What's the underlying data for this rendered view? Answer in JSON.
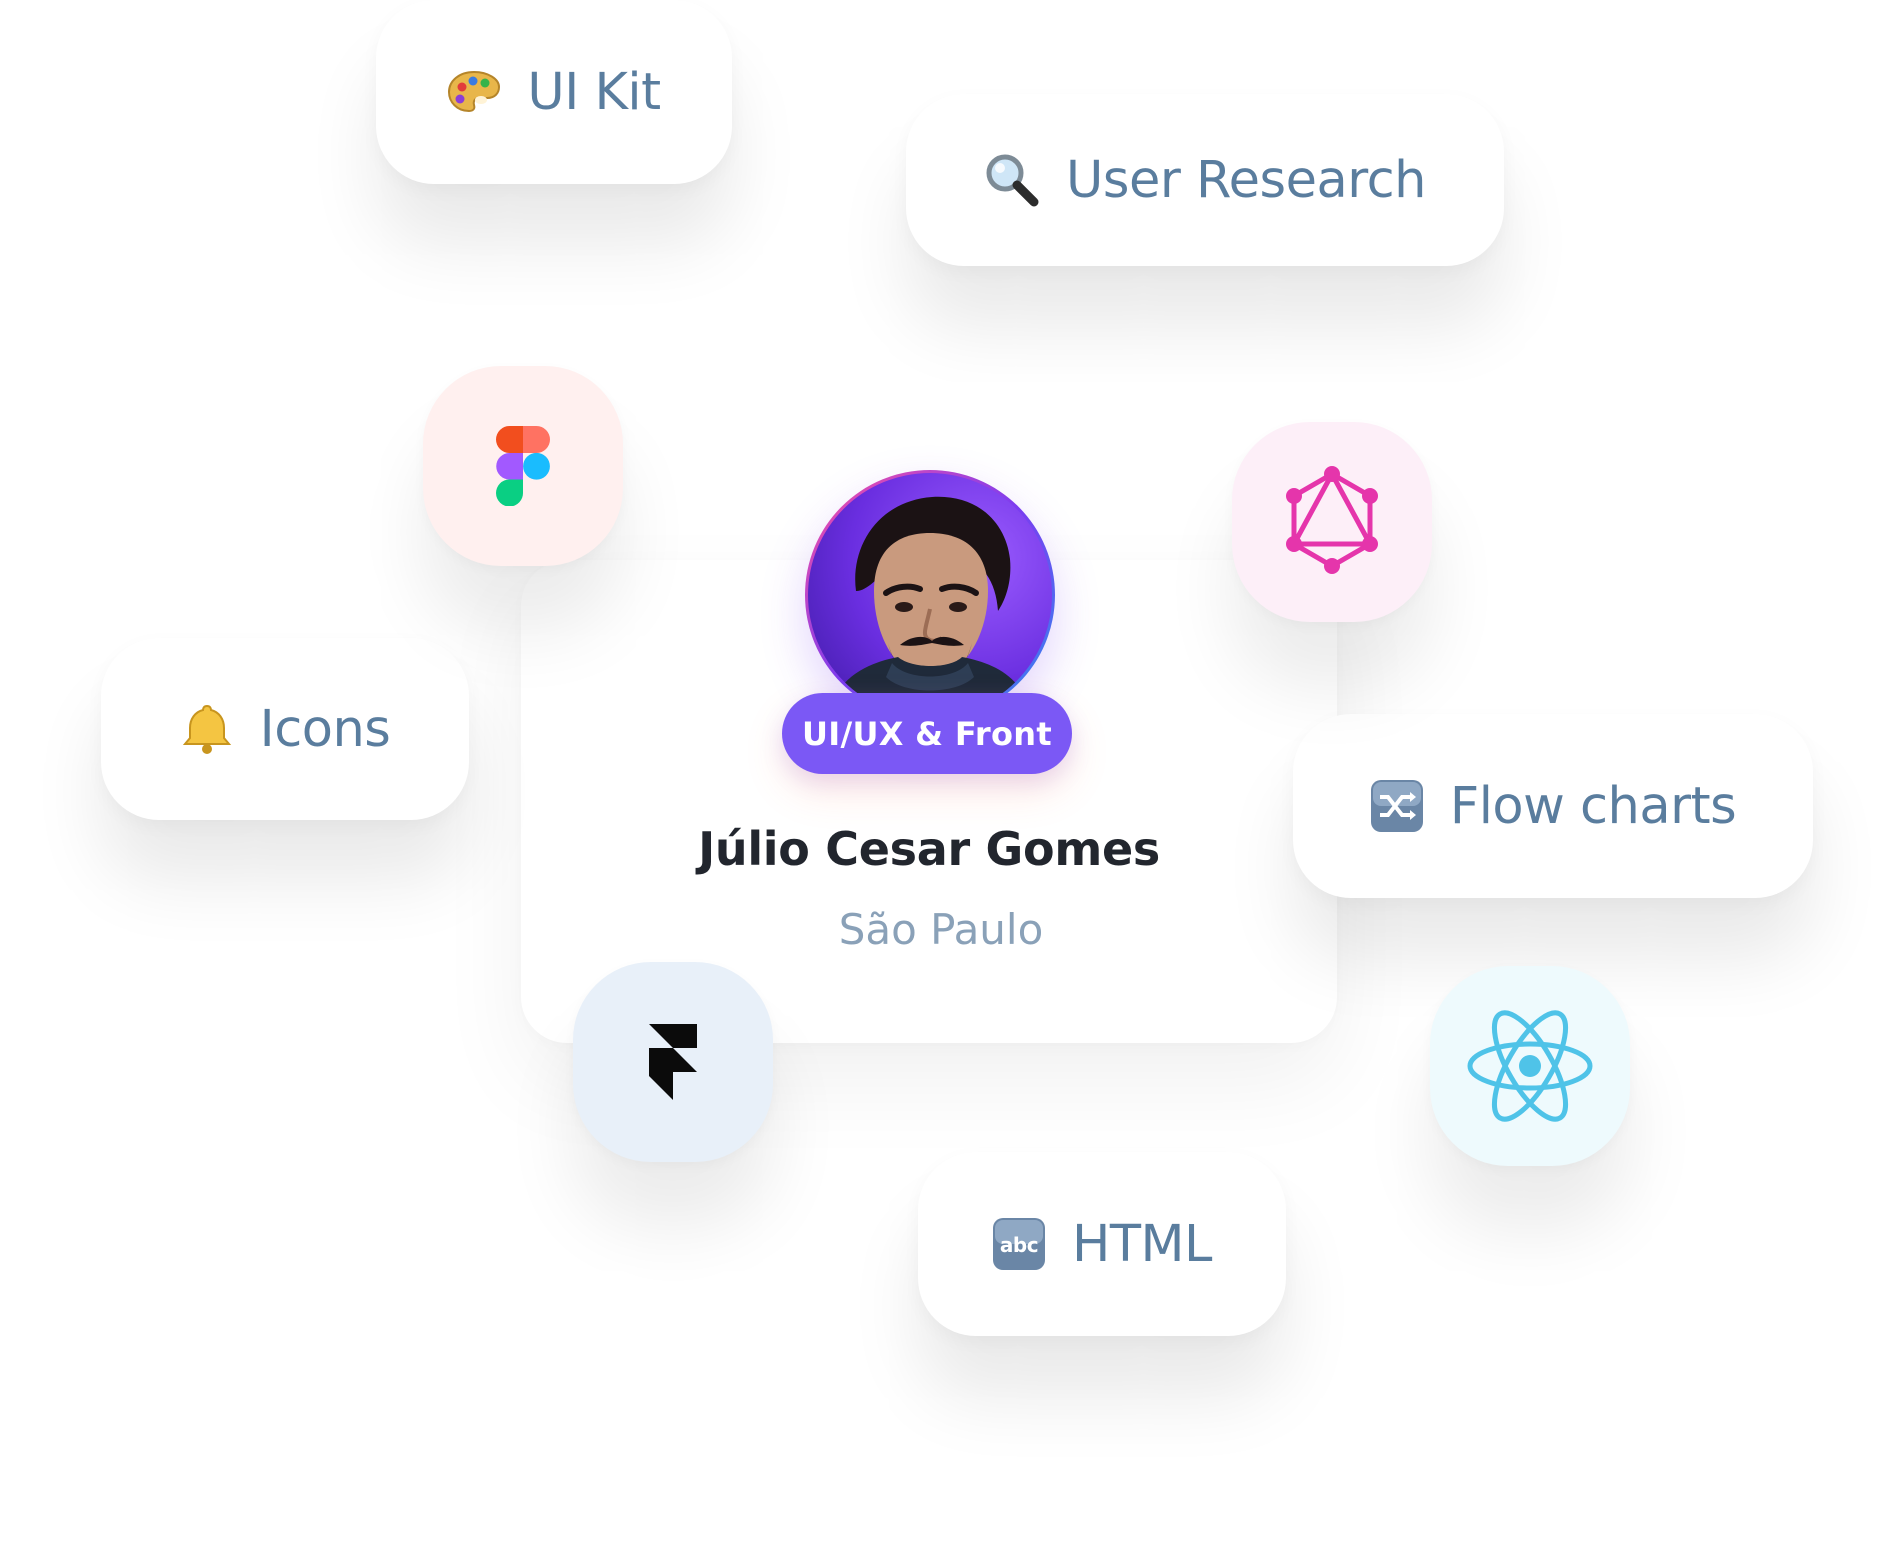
{
  "profile": {
    "role_badge": "UI/UX & Front",
    "name": "Júlio Cesar Gomes",
    "location": "São Paulo"
  },
  "skill_pills": [
    {
      "label": "UI Kit",
      "icon": "artist-palette-icon"
    },
    {
      "label": "User Research",
      "icon": "magnifying-glass-icon"
    },
    {
      "label": "Icons",
      "icon": "bell-icon"
    },
    {
      "label": "Flow charts",
      "icon": "shuffle-icon"
    },
    {
      "label": "HTML",
      "icon": "abc-icon"
    }
  ],
  "tool_tiles": [
    {
      "icon": "figma-icon",
      "background": "#fff0ef"
    },
    {
      "icon": "graphql-icon",
      "background": "#fdeff8"
    },
    {
      "icon": "framer-icon",
      "background": "#e8f0f9"
    },
    {
      "icon": "react-icon",
      "background": "#eefafd"
    }
  ],
  "colors": {
    "pill_text": "#5a7d9e",
    "badge": "#7b58f5",
    "name": "#22262e",
    "location": "#8aa1b8",
    "graphql": "#e535ab",
    "react": "#4fc3e8"
  }
}
